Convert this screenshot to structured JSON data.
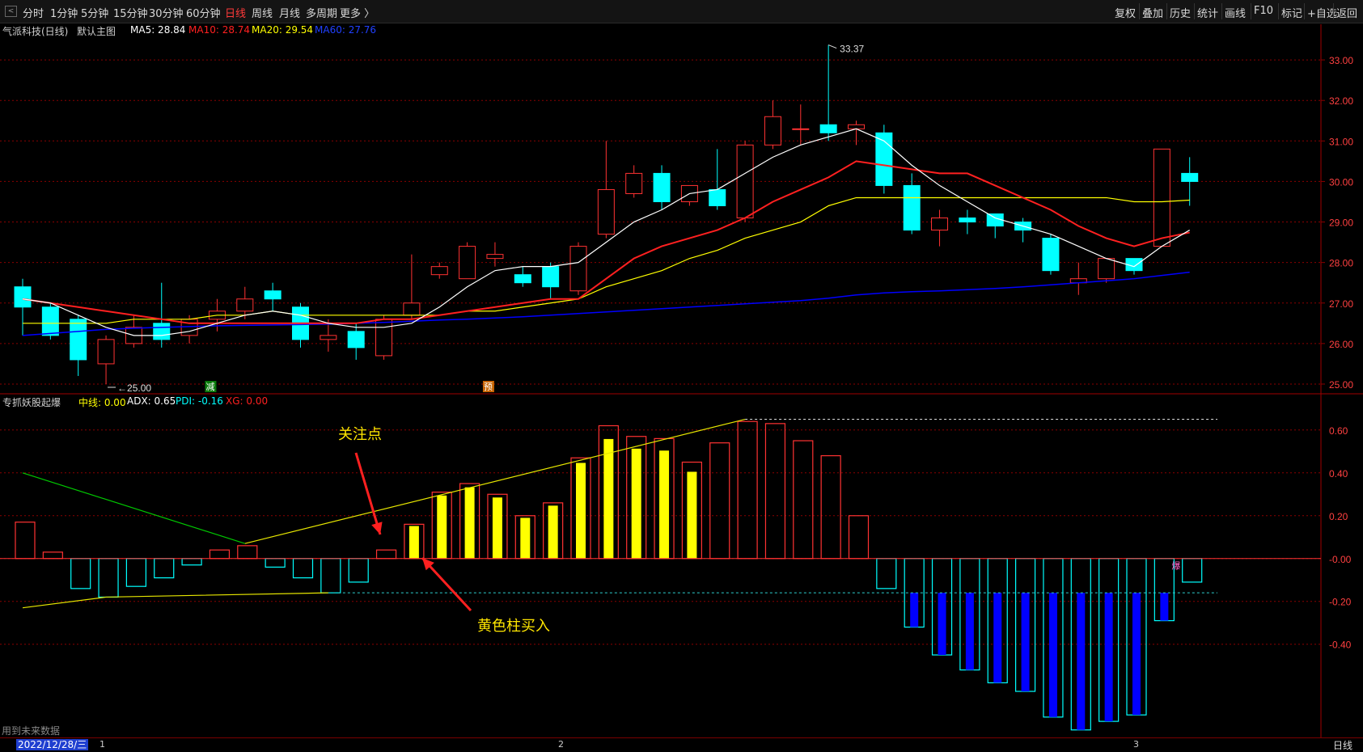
{
  "toolbar": {
    "left": [
      "分时",
      "1分钟",
      "5分钟",
      "15分钟",
      "30分钟",
      "60分钟",
      "日线",
      "周线",
      "月线",
      "多周期",
      "更多 〉"
    ],
    "active_index": 6,
    "right": [
      "复权",
      "叠加",
      "历史",
      "统计",
      "画线",
      "F10",
      "标记",
      "+自选",
      "返回"
    ]
  },
  "main_legend": {
    "stock": "气派科技(日线)",
    "template": "默认主图",
    "ma5": "MA5: 28.84",
    "ma10": "MA10: 28.74",
    "ma20": "MA20: 29.54",
    "ma60": "MA60: 27.76"
  },
  "sub_legend": {
    "name": "专抓妖股起爆",
    "mid": "中线: 0.00",
    "adx": "ADX: 0.65",
    "pdi": "PDI: -0.16",
    "xg": "XG: 0.00"
  },
  "annotations": {
    "focus": "关注点",
    "buy": "黄色柱买入",
    "high": "33.37",
    "low": "25.00",
    "marker_minus": "减",
    "marker_pre": "预",
    "baozha": "爆"
  },
  "status": {
    "date": "2022/12/28/三",
    "months": [
      "1",
      "2",
      "3"
    ],
    "timeframe": "日线",
    "footnote": "用到未来数据"
  },
  "colors": {
    "up": "#ff3232",
    "down": "#00ffff",
    "ma5": "#ffffff",
    "ma10": "#ff2020",
    "ma20": "#ffff00",
    "ma60": "#0000ff",
    "yellow_bar": "#ffff00",
    "blue_bar": "#0000ff",
    "grid": "#8b0000",
    "axis_text": "#ff4040",
    "annot": "#ffe600"
  },
  "chart_data": {
    "type": "candlestick",
    "price_axis": {
      "ticks": [
        "33.00",
        "32.00",
        "31.00",
        "30.00",
        "29.00",
        "28.00",
        "27.00",
        "26.00",
        "25.00"
      ],
      "min": 24.8,
      "max": 33.8
    },
    "candles": [
      [
        27.4,
        26.9,
        27.6,
        26.2
      ],
      [
        26.9,
        26.2,
        27.0,
        26.1
      ],
      [
        26.6,
        25.6,
        26.7,
        25.2
      ],
      [
        25.5,
        26.1,
        26.2,
        25.0
      ],
      [
        26.0,
        26.4,
        26.7,
        25.9
      ],
      [
        26.5,
        26.1,
        27.5,
        25.9
      ],
      [
        26.2,
        26.6,
        26.7,
        26.0
      ],
      [
        26.6,
        26.8,
        27.1,
        26.3
      ],
      [
        26.8,
        27.1,
        27.4,
        26.6
      ],
      [
        27.3,
        27.1,
        27.5,
        26.8
      ],
      [
        26.9,
        26.1,
        27.0,
        25.9
      ],
      [
        26.1,
        26.2,
        26.6,
        25.8
      ],
      [
        26.3,
        25.9,
        26.5,
        25.6
      ],
      [
        25.7,
        26.6,
        26.7,
        25.6
      ],
      [
        26.7,
        27.0,
        28.2,
        26.6
      ],
      [
        27.7,
        27.9,
        28.0,
        27.6
      ],
      [
        27.6,
        28.4,
        28.5,
        27.6
      ],
      [
        28.1,
        28.2,
        28.5,
        27.9
      ],
      [
        27.7,
        27.5,
        27.9,
        27.4
      ],
      [
        27.9,
        27.4,
        28.0,
        27.1
      ],
      [
        27.3,
        28.4,
        28.5,
        27.2
      ],
      [
        28.7,
        29.8,
        31.0,
        28.6
      ],
      [
        29.7,
        30.2,
        30.4,
        29.6
      ],
      [
        30.2,
        29.5,
        30.4,
        29.3
      ],
      [
        29.5,
        29.9,
        29.9,
        29.4
      ],
      [
        29.8,
        29.4,
        30.8,
        29.3
      ],
      [
        29.1,
        30.9,
        31.0,
        29.0
      ],
      [
        30.9,
        31.6,
        32.0,
        30.8
      ],
      [
        31.3,
        31.3,
        31.9,
        30.9
      ],
      [
        31.4,
        31.2,
        33.37,
        31.0
      ],
      [
        31.3,
        31.4,
        31.5,
        30.9
      ],
      [
        31.2,
        29.9,
        31.4,
        29.7
      ],
      [
        29.9,
        28.8,
        30.2,
        28.7
      ],
      [
        28.8,
        29.1,
        29.3,
        28.4
      ],
      [
        29.1,
        29.0,
        29.3,
        28.7
      ],
      [
        29.2,
        28.9,
        29.2,
        28.6
      ],
      [
        29.0,
        28.8,
        29.1,
        28.5
      ],
      [
        28.6,
        27.8,
        28.7,
        27.7
      ],
      [
        27.5,
        27.6,
        28.0,
        27.2
      ],
      [
        27.6,
        28.1,
        28.1,
        27.5
      ],
      [
        28.1,
        27.8,
        28.1,
        27.7
      ],
      [
        28.4,
        30.8,
        30.8,
        28.4
      ],
      [
        30.2,
        30.0,
        30.6,
        29.4
      ]
    ],
    "ma5": [
      27.1,
      27.0,
      26.7,
      26.4,
      26.2,
      26.2,
      26.3,
      26.5,
      26.7,
      26.8,
      26.7,
      26.5,
      26.4,
      26.4,
      26.5,
      26.9,
      27.4,
      27.8,
      27.9,
      27.9,
      28.0,
      28.5,
      29.0,
      29.3,
      29.7,
      29.8,
      30.2,
      30.6,
      30.9,
      31.1,
      31.3,
      31.0,
      30.4,
      29.9,
      29.5,
      29.1,
      28.9,
      28.7,
      28.4,
      28.1,
      27.9,
      28.4,
      28.8
    ],
    "ma10": [
      27.1,
      27.0,
      26.9,
      26.8,
      26.7,
      26.6,
      26.5,
      26.5,
      26.5,
      26.5,
      26.5,
      26.5,
      26.5,
      26.6,
      26.6,
      26.7,
      26.8,
      26.9,
      27.0,
      27.1,
      27.1,
      27.6,
      28.1,
      28.4,
      28.6,
      28.8,
      29.1,
      29.5,
      29.8,
      30.1,
      30.5,
      30.4,
      30.3,
      30.2,
      30.2,
      29.9,
      29.6,
      29.3,
      28.9,
      28.6,
      28.4,
      28.6,
      28.74
    ],
    "ma20": [
      26.5,
      26.5,
      26.5,
      26.5,
      26.6,
      26.6,
      26.6,
      26.7,
      26.7,
      26.8,
      26.7,
      26.7,
      26.7,
      26.7,
      26.7,
      26.7,
      26.8,
      26.8,
      26.9,
      27.0,
      27.1,
      27.4,
      27.6,
      27.8,
      28.1,
      28.3,
      28.6,
      28.8,
      29.0,
      29.4,
      29.6,
      29.6,
      29.6,
      29.6,
      29.6,
      29.6,
      29.6,
      29.6,
      29.6,
      29.6,
      29.5,
      29.5,
      29.54
    ],
    "ma60": [
      26.2,
      26.25,
      26.3,
      26.35,
      26.38,
      26.4,
      26.42,
      26.44,
      26.45,
      26.46,
      26.47,
      26.48,
      26.5,
      26.52,
      26.55,
      26.58,
      26.6,
      26.63,
      26.66,
      26.7,
      26.74,
      26.78,
      26.82,
      26.86,
      26.9,
      26.94,
      26.98,
      27.02,
      27.06,
      27.12,
      27.2,
      27.25,
      27.28,
      27.3,
      27.33,
      27.36,
      27.4,
      27.45,
      27.5,
      27.55,
      27.6,
      27.68,
      27.76
    ],
    "indicator": {
      "axis_ticks": [
        "0.60",
        "0.40",
        "0.20",
        "-0.00",
        "-0.20",
        "-0.40"
      ],
      "min": -0.82,
      "max": 0.72,
      "bars": [
        0.17,
        0.03,
        -0.14,
        -0.18,
        -0.13,
        -0.09,
        -0.03,
        0.04,
        0.06,
        -0.04,
        -0.09,
        -0.16,
        -0.11,
        0.04,
        0.16,
        0.31,
        0.35,
        0.3,
        0.2,
        0.26,
        0.47,
        0.62,
        0.57,
        0.56,
        0.45,
        0.54,
        0.64,
        0.63,
        0.55,
        0.48,
        0.2,
        -0.14,
        -0.32,
        -0.45,
        -0.52,
        -0.58,
        -0.62,
        -0.74,
        -0.8,
        -0.76,
        -0.73,
        -0.29,
        -0.11
      ],
      "yellow": [
        14,
        15,
        16,
        17,
        18,
        19,
        20,
        21,
        22,
        23,
        24
      ],
      "blue": [
        32,
        33,
        34,
        35,
        36,
        37,
        38,
        39,
        40,
        41
      ],
      "blue_inner": [
        -0.16,
        -0.16,
        -0.16,
        -0.16,
        -0.16,
        -0.16,
        -0.16,
        -0.16,
        -0.16,
        -0.16
      ],
      "line_green": [
        [
          0,
          0.4
        ],
        [
          8,
          0.07
        ]
      ],
      "line_yellow_up": [
        [
          8,
          0.07
        ],
        [
          26,
          0.65
        ]
      ],
      "line_yellow_low": [
        [
          0,
          -0.23
        ],
        [
          3,
          -0.18
        ],
        [
          11,
          -0.16
        ]
      ],
      "dash_top": 0.65,
      "dash_low": -0.16
    }
  }
}
